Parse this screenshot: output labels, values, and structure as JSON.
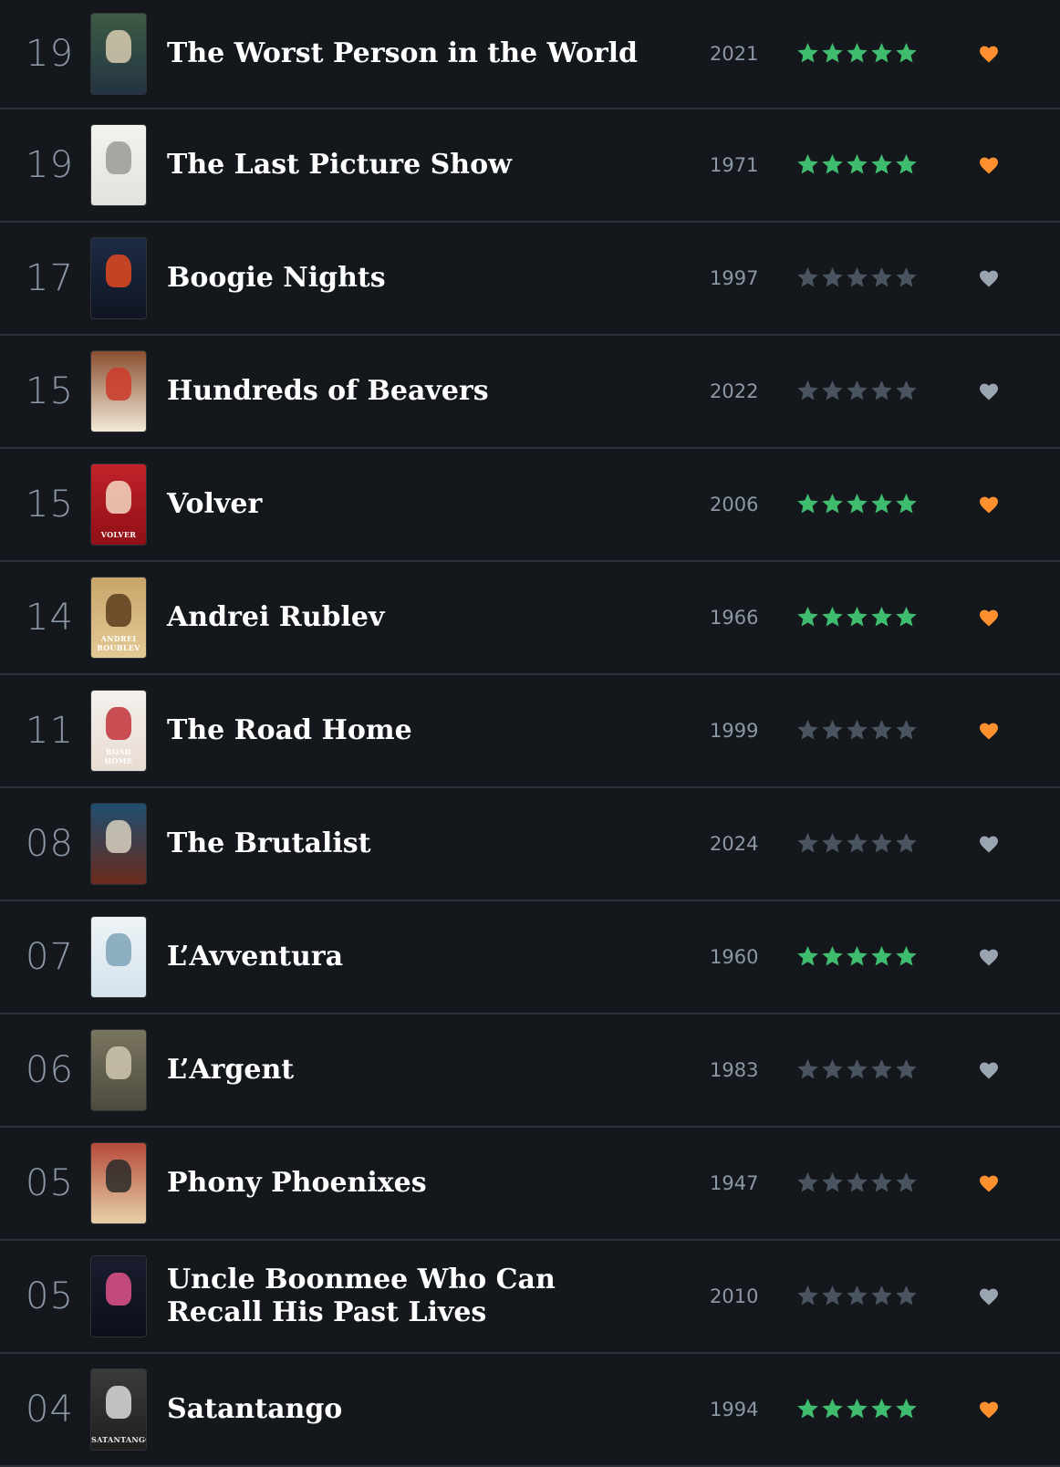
{
  "colors": {
    "background": "#14181d",
    "divider": "#2a323c",
    "star_rated": "#40bc6f",
    "star_unrated": "#4a5360",
    "heart_liked": "#ff9030",
    "heart_unliked": "#9aa5b1",
    "title": "#ffffff",
    "muted": "#8b97a5"
  },
  "entries": [
    {
      "day": "19",
      "title": "The Worst Person in the World",
      "year": "2021",
      "rating": 5,
      "liked": true,
      "poster": {
        "top": "#3e5b44",
        "bottom": "#243443",
        "accent": "#d8ccb0",
        "text": ""
      }
    },
    {
      "day": "19",
      "title": "The Last Picture Show",
      "year": "1971",
      "rating": 5,
      "liked": true,
      "poster": {
        "top": "#f2f2ef",
        "bottom": "#e2e2de",
        "accent": "#9a9a96",
        "text": ""
      }
    },
    {
      "day": "17",
      "title": "Boogie Nights",
      "year": "1997",
      "rating": 0,
      "liked": false,
      "poster": {
        "top": "#1d2b45",
        "bottom": "#0f1522",
        "accent": "#e04a22",
        "text": ""
      }
    },
    {
      "day": "15",
      "title": "Hundreds of Beavers",
      "year": "2022",
      "rating": 0,
      "liked": false,
      "poster": {
        "top": "#8a4e2f",
        "bottom": "#f2ead9",
        "accent": "#cc3a2a",
        "text": ""
      }
    },
    {
      "day": "15",
      "title": "Volver",
      "year": "2006",
      "rating": 5,
      "liked": true,
      "poster": {
        "top": "#c22229",
        "bottom": "#8f0f16",
        "accent": "#f3d7c2",
        "text": "VOLVER"
      }
    },
    {
      "day": "14",
      "title": "Andrei Rublev",
      "year": "1966",
      "rating": 5,
      "liked": true,
      "poster": {
        "top": "#c9a56a",
        "bottom": "#e3c995",
        "accent": "#5a3d1c",
        "text": "ANDREI ROUBLEV"
      }
    },
    {
      "day": "11",
      "title": "The Road Home",
      "year": "1999",
      "rating": 0,
      "liked": true,
      "poster": {
        "top": "#f4f0ec",
        "bottom": "#e8dcd3",
        "accent": "#c2323a",
        "text": "ROAD HOME"
      }
    },
    {
      "day": "08",
      "title": "The Brutalist",
      "year": "2024",
      "rating": 0,
      "liked": false,
      "poster": {
        "top": "#1f4f70",
        "bottom": "#6a2a1c",
        "accent": "#d8d0c0",
        "text": ""
      }
    },
    {
      "day": "07",
      "title": "L’Avventura",
      "year": "1960",
      "rating": 5,
      "liked": false,
      "poster": {
        "top": "#eef3f6",
        "bottom": "#d4e3ec",
        "accent": "#7fa3b8",
        "text": ""
      }
    },
    {
      "day": "06",
      "title": "L’Argent",
      "year": "1983",
      "rating": 0,
      "liked": false,
      "poster": {
        "top": "#7a7560",
        "bottom": "#4e4b3e",
        "accent": "#d0c8b0",
        "text": ""
      }
    },
    {
      "day": "05",
      "title": "Phony Phoenixes",
      "year": "1947",
      "rating": 0,
      "liked": true,
      "poster": {
        "top": "#b64a3a",
        "bottom": "#e6d0a8",
        "accent": "#2a2a2a",
        "text": ""
      }
    },
    {
      "day": "05",
      "title": "Uncle Boonmee Who Can Recall His Past Lives",
      "year": "2010",
      "rating": 0,
      "liked": false,
      "poster": {
        "top": "#1a1d2e",
        "bottom": "#0c0f1a",
        "accent": "#e0548a",
        "text": ""
      }
    },
    {
      "day": "04",
      "title": "Satantango",
      "year": "1994",
      "rating": 5,
      "liked": true,
      "poster": {
        "top": "#3b3b3b",
        "bottom": "#1f1f1f",
        "accent": "#dcdcdc",
        "text": "SATANTANGO"
      }
    }
  ]
}
